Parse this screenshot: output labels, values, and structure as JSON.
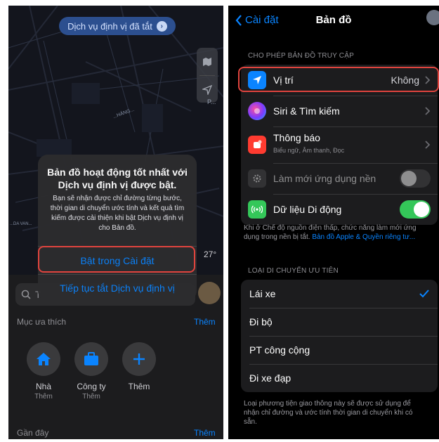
{
  "left": {
    "location_pill": "Dịch vụ định vị đã tắt",
    "map_labels": {
      "place1": "P...",
      "place2": "...HÁNG...",
      "place3": "...DA VAN..."
    },
    "temperature": "27°",
    "dialog": {
      "title": "Bản đồ hoạt động tốt nhất với Dịch vụ định vị được bật.",
      "body": "Bạn sẽ nhận được chỉ đường từng bước, thời gian di chuyển ước tính và kết quả tìm kiếm được cải thiện khi bật Dịch vụ định vị cho Bản đồ.",
      "primary_button": "Bật trong Cài đặt",
      "secondary_button": "Tiếp tục tắt Dịch vụ định vị"
    },
    "search_placeholder": "T",
    "favorites": {
      "title": "Mục ưa thích",
      "more": "Thêm",
      "items": [
        {
          "name": "Nhà",
          "sub": "Thêm",
          "icon": "house-icon"
        },
        {
          "name": "Công ty",
          "sub": "Thêm",
          "icon": "briefcase-icon"
        },
        {
          "name": "Thêm",
          "sub": "",
          "icon": "plus-icon"
        }
      ]
    },
    "recents": {
      "title": "Gần đây",
      "more": "Thêm"
    }
  },
  "right": {
    "back_label": "Cài đặt",
    "title": "Bản đồ",
    "access_header": "CHO PHÉP BẢN ĐỒ TRUY CẬP",
    "access_rows": [
      {
        "label": "Vị trí",
        "value": "Không",
        "icon": "location-arrow-icon",
        "color": "#0a84ff"
      },
      {
        "label": "Siri & Tìm kiếm",
        "icon": "siri-icon"
      },
      {
        "label": "Thông báo",
        "sub": "Biểu ngữ, Âm thanh, Đọc",
        "icon": "notification-icon",
        "color": "#ff3b30"
      },
      {
        "label": "Làm mới ứng dụng nền",
        "icon": "gear-icon",
        "toggle": false
      },
      {
        "label": "Dữ liệu Di động",
        "icon": "cellular-icon",
        "color": "#34c759",
        "toggle": true
      }
    ],
    "low_power_note": "Khi ở Chế độ nguồn điện thấp, chức năng làm mới ứng dụng trong nền bị tắt.",
    "low_power_link": "Bản đồ Apple & Quyền riêng tư...",
    "transport_header": "LOẠI DI CHUYỂN ƯU TIÊN",
    "transport_rows": [
      {
        "label": "Lái xe",
        "selected": true
      },
      {
        "label": "Đi bộ",
        "selected": false
      },
      {
        "label": "PT công cộng",
        "selected": false
      },
      {
        "label": "Đi xe đạp",
        "selected": false
      }
    ],
    "transport_note": "Loại phương tiện giao thông này sẽ được sử dụng để nhận chỉ đường và ước tính thời gian di chuyển khi có sẵn."
  }
}
